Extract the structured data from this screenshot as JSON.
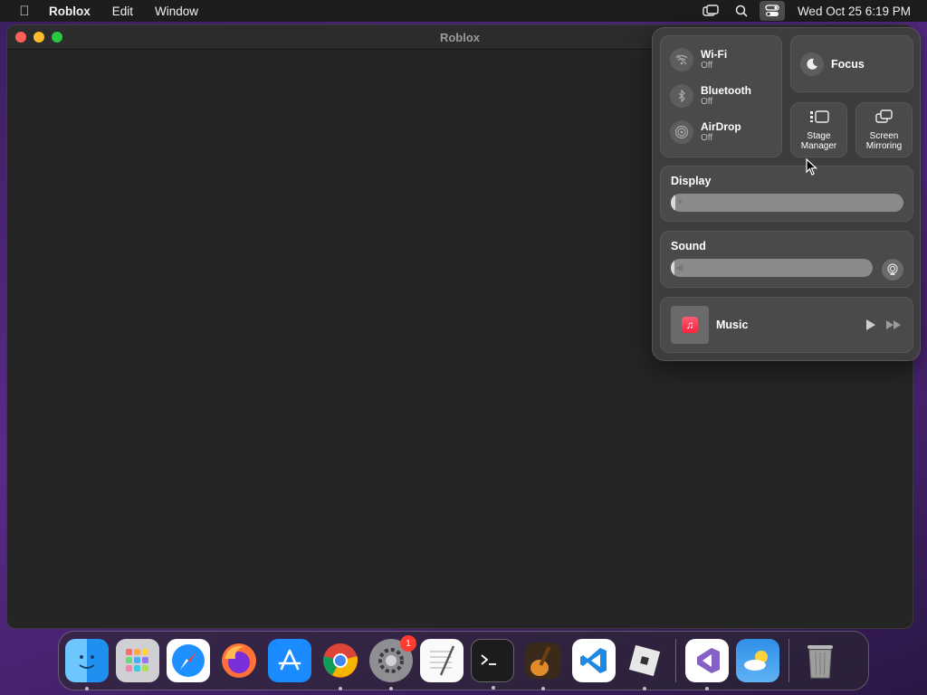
{
  "menubar": {
    "app_name": "Roblox",
    "menus": [
      "Edit",
      "Window"
    ],
    "clock": "Wed Oct 25  6:19 PM"
  },
  "window": {
    "title": "Roblox"
  },
  "control_center": {
    "wifi": {
      "label": "Wi-Fi",
      "status": "Off"
    },
    "bluetooth": {
      "label": "Bluetooth",
      "status": "Off"
    },
    "airdrop": {
      "label": "AirDrop",
      "status": "Off"
    },
    "focus": {
      "label": "Focus"
    },
    "stage_manager": {
      "line1": "Stage",
      "line2": "Manager"
    },
    "screen_mirroring": {
      "line1": "Screen",
      "line2": "Mirroring"
    },
    "display": {
      "label": "Display",
      "level": 0.02
    },
    "sound": {
      "label": "Sound",
      "level": 0.02
    },
    "music": {
      "label": "Music"
    }
  },
  "dock": {
    "apps": [
      "finder-icon",
      "launchpad-icon",
      "safari-icon",
      "firefox-icon",
      "app-store-icon",
      "chrome-icon",
      "system-settings-icon",
      "textedit-icon",
      "terminal-icon",
      "garageband-icon",
      "vscode-icon",
      "roblox-icon",
      "visual-studio-icon",
      "weather-icon",
      "trash-icon"
    ],
    "settings_badge": "1"
  }
}
